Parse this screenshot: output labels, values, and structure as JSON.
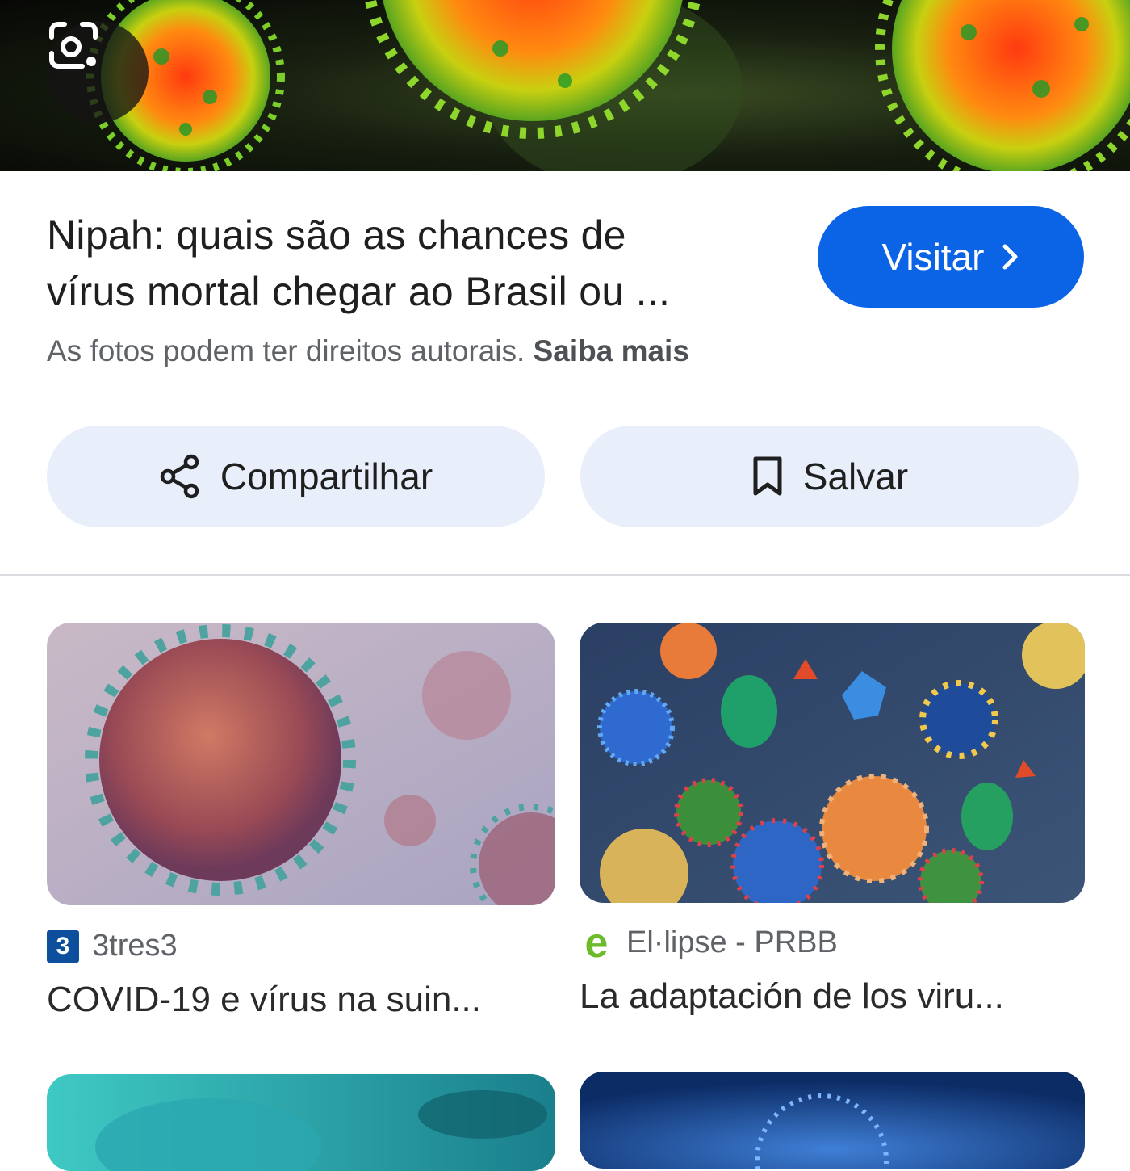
{
  "hero": {
    "camera_icon": "google-lens-icon"
  },
  "result": {
    "title_line1": "Nipah: quais são as chances de",
    "title_line2": "vírus mortal chegar ao Brasil ou ...",
    "visit_label": "Visitar",
    "visit_icon": "chevron-right-icon",
    "copyright_text": "As fotos podem ter direitos autorais.",
    "learn_more": "Saiba mais"
  },
  "actions": {
    "share_label": "Compartilhar",
    "share_icon": "share-icon",
    "save_label": "Salvar",
    "save_icon": "bookmark-icon"
  },
  "related": [
    {
      "favicon_text": "3",
      "source": "3tres3",
      "title": "COVID-19 e vírus na suin..."
    },
    {
      "favicon_text": "e",
      "source": "El·lipse - PRBB",
      "title": "La adaptación de los viru..."
    }
  ],
  "colors": {
    "accent": "#0b63e5",
    "button_bg": "#e8effb",
    "secondary_text": "#5f6368"
  }
}
